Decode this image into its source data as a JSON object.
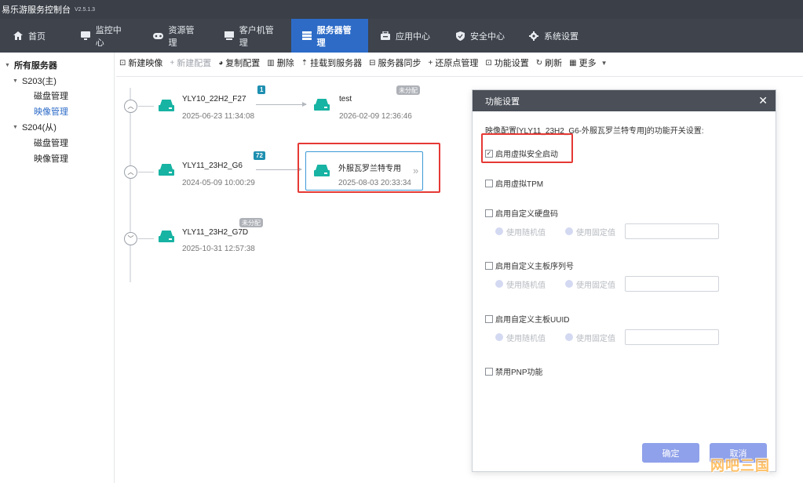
{
  "app": {
    "title": "易乐游服务控制台",
    "version": "V2.5.1.3"
  },
  "menu": [
    {
      "label": "首页",
      "icon": "home-icon"
    },
    {
      "label": "监控中心",
      "icon": "monitor-icon"
    },
    {
      "label": "资源管理",
      "icon": "gamepad-icon"
    },
    {
      "label": "客户机管理",
      "icon": "client-pc-icon"
    },
    {
      "label": "服务器管理",
      "icon": "server-list-icon",
      "active": true
    },
    {
      "label": "应用中心",
      "icon": "app-center-icon"
    },
    {
      "label": "安全中心",
      "icon": "shield-icon"
    },
    {
      "label": "系统设置",
      "icon": "gear-icon"
    }
  ],
  "sidebar": {
    "root": "所有服务器",
    "servers": [
      {
        "label": "S203(主)",
        "children": [
          "磁盘管理",
          "映像管理"
        ]
      },
      {
        "label": "S204(从)",
        "children": [
          "磁盘管理",
          "映像管理"
        ]
      }
    ]
  },
  "toolbar": [
    {
      "label": "新建映像",
      "icon": "new-image-icon",
      "glyph": "⊡"
    },
    {
      "label": "新建配置",
      "icon": "plus-icon",
      "glyph": "+",
      "disabled": true
    },
    {
      "label": "复制配置",
      "icon": "copy-icon",
      "glyph": "◕"
    },
    {
      "label": "删除",
      "icon": "trash-icon",
      "glyph": "▥"
    },
    {
      "label": "挂载到服务器",
      "icon": "upload-icon",
      "glyph": "⇡"
    },
    {
      "label": "服务器同步",
      "icon": "sync-icon",
      "glyph": "⊟"
    },
    {
      "label": "还原点管理",
      "icon": "plus-icon",
      "glyph": "+"
    },
    {
      "label": "功能设置",
      "icon": "settings-box-icon",
      "glyph": "⊡"
    },
    {
      "label": "刷新",
      "icon": "refresh-icon",
      "glyph": "↻"
    },
    {
      "label": "更多",
      "icon": "grid-icon",
      "glyph": "▦",
      "caret": "▼"
    }
  ],
  "images": [
    {
      "name": "YLY10_22H2_F27",
      "time": "2025-06-23 11:34:08",
      "badge": "1",
      "config": {
        "name": "test",
        "time": "2026-02-09 12:36:46",
        "badge": "未分配"
      }
    },
    {
      "name": "YLY11_23H2_G6",
      "time": "2024-05-09 10:00:29",
      "badge": "72",
      "config": {
        "name": "外服瓦罗兰特专用",
        "time": "2025-08-03 20:33:34"
      }
    },
    {
      "name": "YLY11_23H2_G7D",
      "time": "2025-10-31 12:57:38",
      "badge": "未分配"
    }
  ],
  "dialog": {
    "title": "功能设置",
    "description": "映像配置[YLY11_23H2_G6-外服瓦罗兰特专用]的功能开关设置:",
    "options": [
      {
        "label": "启用虚拟安全启动",
        "checked": true
      },
      {
        "label": "启用虚拟TPM",
        "checked": false
      },
      {
        "label": "启用自定义硬盘码",
        "checked": false
      },
      {
        "label": "启用自定义主板序列号",
        "checked": false
      },
      {
        "label": "启用自定义主板UUID",
        "checked": false
      },
      {
        "label": "禁用PNP功能",
        "checked": false
      }
    ],
    "random_label": "使用随机值",
    "fixed_label": "使用固定值",
    "ok": "确定",
    "cancel": "取消"
  },
  "watermark": "网吧三国"
}
